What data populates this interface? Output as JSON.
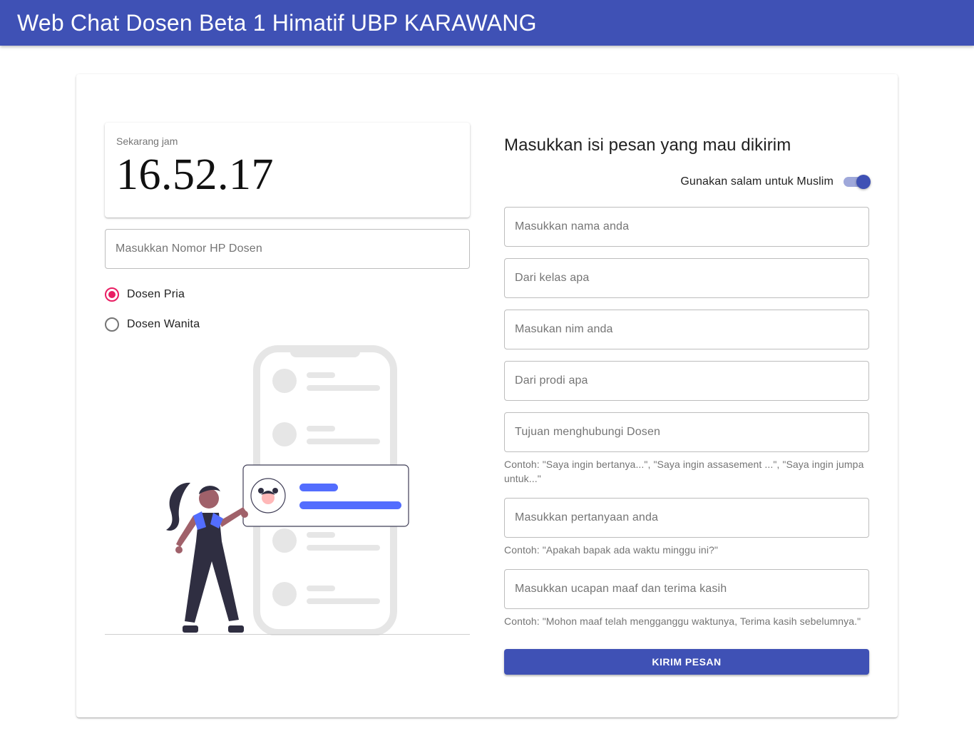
{
  "appbar": {
    "title": "Web Chat Dosen Beta 1 Himatif UBP KARAWANG"
  },
  "clock": {
    "label": "Sekarang jam",
    "time": "16.52.17"
  },
  "phone_input": {
    "placeholder": "Masukkan Nomor HP Dosen"
  },
  "gender": {
    "selected": "Dosen Pria",
    "options": [
      {
        "label": "Dosen Pria",
        "checked": true
      },
      {
        "label": "Dosen Wanita",
        "checked": false
      }
    ]
  },
  "form": {
    "heading": "Masukkan isi pesan yang mau dikirim",
    "switch_label": "Gunakan salam untuk Muslim",
    "switch_on": true,
    "fields": [
      {
        "placeholder": "Masukkan nama anda"
      },
      {
        "placeholder": "Dari kelas apa"
      },
      {
        "placeholder": "Masukan nim anda"
      },
      {
        "placeholder": "Dari prodi apa"
      },
      {
        "placeholder": "Tujuan menghubungi Dosen",
        "hint": "Contoh: \"Saya ingin bertanya...\", \"Saya ingin assasement ...\", \"Saya ingin jumpa untuk...\""
      },
      {
        "placeholder": "Masukkan pertanyaan anda",
        "hint": "Contoh: \"Apakah bapak ada waktu minggu ini?\""
      },
      {
        "placeholder": "Masukkan ucapan maaf dan terima kasih",
        "hint": "Contoh: \"Mohon maaf telah mengganggu waktunya, Terima kasih sebelumnya.\""
      }
    ],
    "submit_label": "KIRIM PESAN"
  },
  "colors": {
    "primary": "#3f51b5",
    "accent": "#e91e63",
    "illustration_blue": "#536dfe"
  }
}
